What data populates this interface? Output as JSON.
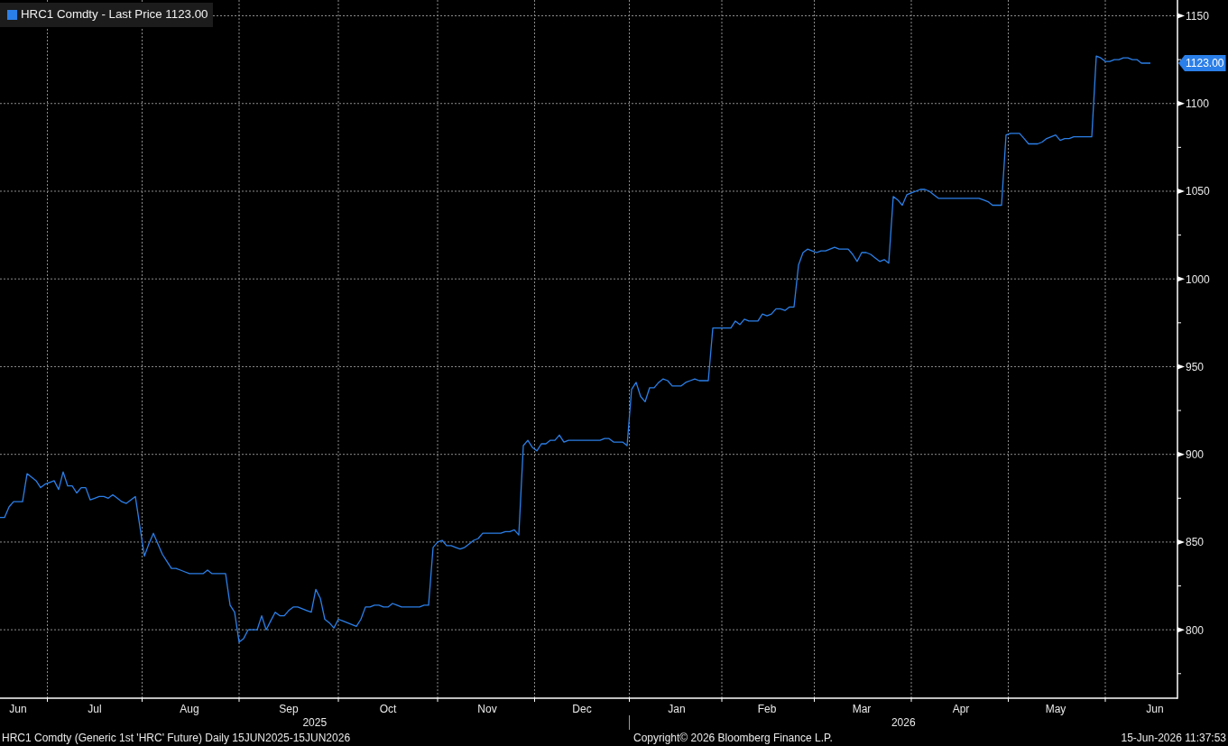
{
  "chart": {
    "chart_data": {
      "type": "line",
      "grid": true,
      "ylim": [
        761,
        1159
      ],
      "yticks": [
        800,
        850,
        900,
        950,
        1000,
        1050,
        1100,
        1150
      ],
      "categories": [
        null,
        null,
        null,
        null,
        "Jun",
        null,
        null,
        null,
        null,
        null,
        null,
        null,
        null,
        null,
        null,
        null,
        null,
        null,
        null,
        null,
        null,
        "Jul",
        null,
        null,
        null,
        null,
        null,
        null,
        null,
        null,
        null,
        null,
        null,
        null,
        null,
        null,
        null,
        null,
        null,
        null,
        null,
        null,
        "Aug",
        null,
        null,
        null,
        null,
        null,
        null,
        null,
        null,
        null,
        null,
        null,
        null,
        null,
        null,
        null,
        null,
        null,
        null,
        null,
        null,
        null,
        "Sep",
        null,
        null,
        null,
        null,
        null,
        null,
        null,
        null,
        null,
        null,
        null,
        null,
        null,
        null,
        null,
        null,
        null,
        null,
        null,
        null,
        null,
        "Oct",
        null,
        null,
        null,
        null,
        null,
        null,
        null,
        null,
        null,
        null,
        null,
        null,
        null,
        null,
        null,
        null,
        null,
        null,
        null,
        null,
        null,
        "Nov",
        null,
        null,
        null,
        null,
        null,
        null,
        null,
        null,
        null,
        null,
        null,
        null,
        null,
        null,
        null,
        null,
        null,
        null,
        null,
        null,
        "Dec",
        null,
        null,
        null,
        null,
        null,
        null,
        null,
        null,
        null,
        null,
        null,
        null,
        null,
        null,
        null,
        null,
        null,
        null,
        null,
        null,
        "Jan",
        null,
        null,
        null,
        null,
        null,
        null,
        null,
        null,
        null,
        null,
        null,
        null,
        null,
        null,
        null,
        null,
        null,
        null,
        null,
        "Feb",
        null,
        null,
        null,
        null,
        null,
        null,
        null,
        null,
        null,
        null,
        null,
        null,
        null,
        null,
        null,
        null,
        null,
        null,
        null,
        null,
        "Mar",
        null,
        null,
        null,
        null,
        null,
        null,
        null,
        null,
        null,
        null,
        null,
        null,
        null,
        null,
        null,
        null,
        null,
        null,
        null,
        null,
        null,
        "Apr",
        null,
        null,
        null,
        null,
        null,
        null,
        null,
        null,
        null,
        null,
        null,
        null,
        null,
        null,
        null,
        null,
        null,
        null,
        null,
        null,
        "May",
        null,
        null,
        null,
        null,
        null,
        null,
        null,
        null,
        null,
        null,
        null,
        null,
        null,
        null,
        null,
        null,
        null,
        null,
        null,
        null,
        null,
        "Jun",
        null,
        null,
        null,
        null
      ],
      "annotations": [
        "2025",
        "2026"
      ],
      "series": [
        {
          "name": "HRC1 Comdty - Last Price 1123.00",
          "color": "#2b7fe8",
          "values": [
            864,
            864,
            870,
            873,
            873,
            873,
            889,
            887,
            885,
            881,
            883,
            884,
            885,
            880,
            890,
            882,
            882,
            878,
            881,
            881,
            874,
            875,
            876,
            876,
            875,
            877,
            875,
            873,
            872,
            874,
            876,
            859,
            842,
            849,
            855,
            849,
            843,
            839,
            835,
            835,
            834,
            833,
            832,
            832,
            832,
            832,
            834,
            832,
            832,
            832,
            832,
            814,
            810,
            793,
            795,
            800,
            800,
            800,
            808,
            800,
            805,
            810,
            808,
            808,
            811,
            813,
            813,
            812,
            811,
            810,
            823,
            818,
            806,
            804,
            801,
            806,
            805,
            804,
            803,
            802,
            806,
            813,
            813,
            814,
            814,
            813,
            813,
            815,
            814,
            813,
            813,
            813,
            813,
            813,
            814,
            814,
            847,
            850,
            851,
            848,
            848,
            847,
            846,
            847,
            849,
            851,
            852,
            855,
            855,
            855,
            855,
            855,
            856,
            856,
            857,
            854,
            905,
            908,
            904,
            902,
            906,
            906,
            908,
            908,
            911,
            907,
            908,
            908,
            908,
            908,
            908,
            908,
            908,
            908,
            909,
            909,
            907,
            907,
            907,
            905,
            937,
            941,
            933,
            930,
            938,
            938,
            941,
            943,
            942,
            939,
            939,
            939,
            941,
            942,
            943,
            942,
            942,
            942,
            972,
            972,
            972,
            972,
            972,
            976,
            974,
            977,
            976,
            976,
            976,
            980,
            979,
            980,
            983,
            983,
            982,
            984,
            984,
            1008,
            1015,
            1017,
            1016,
            1015,
            1016,
            1016,
            1017,
            1018,
            1017,
            1017,
            1017,
            1014,
            1010,
            1015,
            1015,
            1014,
            1012,
            1010,
            1011,
            1009,
            1047,
            1045,
            1042,
            1048,
            1049,
            1050,
            1051,
            1051,
            1050,
            1048,
            1046,
            1046,
            1046,
            1046,
            1046,
            1046,
            1046,
            1046,
            1046,
            1046,
            1045,
            1044,
            1042,
            1042,
            1042,
            1082,
            1083,
            1083,
            1083,
            1080,
            1077,
            1077,
            1077,
            1078,
            1080,
            1081,
            1082,
            1079,
            1080,
            1080,
            1081,
            1081,
            1081,
            1081,
            1081,
            1127,
            1126,
            1124,
            1124,
            1125,
            1125,
            1126,
            1126,
            1125,
            1125,
            1123,
            1123,
            1123,
            null,
            null,
            null,
            null,
            null
          ]
        }
      ]
    },
    "last_price_tag": "1123.00"
  },
  "footer": {
    "description": "HRC1 Comdty (Generic 1st 'HRC' Future) Daily 15JUN2025-15JUN2026",
    "copyright": "Copyright© 2026 Bloomberg Finance L.P.",
    "timestamp": "15-Jun-2026 11:37:53"
  }
}
